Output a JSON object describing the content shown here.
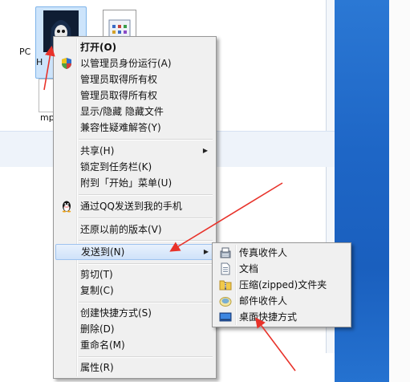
{
  "explorer": {
    "file1_partial_label": "PC",
    "file2_partial_label": "H",
    "file3_partial_label": "mp"
  },
  "menu": {
    "items": [
      {
        "label": "打开(O)",
        "icon": "none"
      },
      {
        "label": "以管理员身份运行(A)",
        "icon": "uac-shield-icon"
      },
      {
        "label": "管理员取得所有权",
        "icon": "none"
      },
      {
        "label": "管理员取得所有权",
        "icon": "none"
      },
      {
        "label": "显示/隐藏 隐藏文件",
        "icon": "none"
      },
      {
        "label": "兼容性疑难解答(Y)",
        "icon": "none"
      },
      {
        "label": "共享(H)",
        "icon": "none",
        "submenu": true
      },
      {
        "label": "锁定到任务栏(K)",
        "icon": "none"
      },
      {
        "label": "附到「开始」菜单(U)",
        "icon": "none"
      },
      {
        "label": "通过QQ发送到我的手机",
        "icon": "qq-penguin-icon"
      },
      {
        "label": "还原以前的版本(V)",
        "icon": "none"
      },
      {
        "label": "发送到(N)",
        "icon": "none",
        "submenu": true
      },
      {
        "label": "剪切(T)",
        "icon": "none"
      },
      {
        "label": "复制(C)",
        "icon": "none"
      },
      {
        "label": "创建快捷方式(S)",
        "icon": "none"
      },
      {
        "label": "删除(D)",
        "icon": "none"
      },
      {
        "label": "重命名(M)",
        "icon": "none"
      },
      {
        "label": "属性(R)",
        "icon": "none"
      }
    ]
  },
  "submenu": {
    "items": [
      {
        "label": "传真收件人",
        "icon": "fax-icon"
      },
      {
        "label": "文档",
        "icon": "document-icon"
      },
      {
        "label": "压缩(zipped)文件夹",
        "icon": "zip-folder-icon"
      },
      {
        "label": "邮件收件人",
        "icon": "mail-icon"
      },
      {
        "label": "桌面快捷方式",
        "icon": "desktop-icon"
      }
    ]
  },
  "colors": {
    "menu_bg": "#f0f0f0",
    "highlight": "#cfe2fa",
    "annotation_arrow": "#e8322a",
    "desktop_blue": "#1e66c6"
  }
}
